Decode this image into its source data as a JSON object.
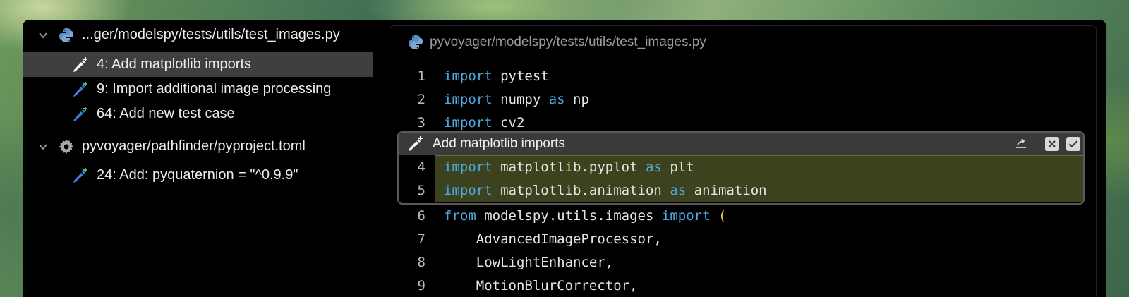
{
  "sidebar": {
    "groups": [
      {
        "file": "...ger/modelspy/tests/utils/test_images.py",
        "icon": "python-icon",
        "changes": [
          {
            "label": "4: Add matplotlib imports",
            "selected": true
          },
          {
            "label": "9: Import additional image processing",
            "selected": false
          },
          {
            "label": "64: Add new test case",
            "selected": false
          }
        ]
      },
      {
        "file": "pyvoyager/pathfinder/pyproject.toml",
        "icon": "gear-icon",
        "changes": [
          {
            "label": "24: Add: pyquaternion = \"^0.9.9\"",
            "selected": false
          }
        ]
      }
    ]
  },
  "editor": {
    "path": "pyvoyager/modelspy/tests/utils/test_images.py",
    "lines_before": [
      {
        "n": "1",
        "kw": "import",
        "rest": " pytest"
      },
      {
        "n": "2",
        "kw": "import",
        "rest": " numpy ",
        "kw2": "as",
        "rest2": " np"
      },
      {
        "n": "3",
        "kw": "import",
        "rest": " cv2"
      }
    ],
    "diff": {
      "title": "Add matplotlib imports",
      "lines": [
        {
          "n": "4",
          "kw": "import",
          "rest": " matplotlib.pyplot ",
          "kw2": "as",
          "rest2": " plt"
        },
        {
          "n": "5",
          "kw": "import",
          "rest": " matplotlib.animation ",
          "kw2": "as",
          "rest2": " animation"
        }
      ]
    },
    "lines_after": [
      {
        "n": "6",
        "kw": "from",
        "rest": " modelspy.utils.images ",
        "kw2": "import",
        "rest2": " ",
        "paren": "("
      },
      {
        "n": "7",
        "rest": "    AdvancedImageProcessor,"
      },
      {
        "n": "8",
        "rest": "    LowLightEnhancer,"
      },
      {
        "n": "9",
        "rest": "    MotionBlurCorrector,"
      }
    ]
  },
  "colors": {
    "keyword": "#4fa8e0",
    "diff_highlight": "#3c421e",
    "selection": "#3f3f3f"
  }
}
